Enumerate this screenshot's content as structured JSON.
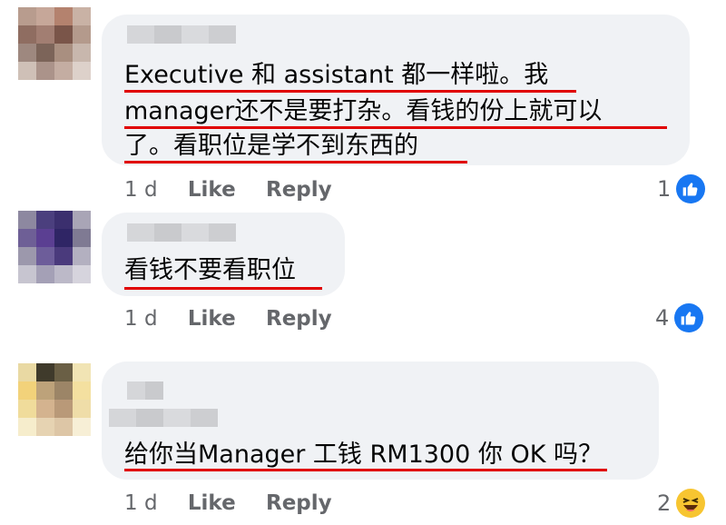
{
  "comments": [
    {
      "lines": [
        "Executive 和 assistant 都一样啦。我",
        "manager还不是要打杂。看钱的份上就可以",
        "了。看职位是学不到东西的"
      ],
      "time": "1 d",
      "like_label": "Like",
      "reply_label": "Reply",
      "reaction_count": "1",
      "reaction_icon": "like-icon"
    },
    {
      "lines": [
        "看钱不要看职位"
      ],
      "time": "1 d",
      "like_label": "Like",
      "reply_label": "Reply",
      "reaction_count": "4",
      "reaction_icon": "like-icon"
    },
    {
      "lines": [
        "给你当Manager 工钱 RM1300 你 OK 吗？"
      ],
      "time": "1 d",
      "like_label": "Like",
      "reply_label": "Reply",
      "reaction_count": "2",
      "reaction_icon": "haha-icon"
    }
  ],
  "colors": {
    "bubble": "#f0f2f5",
    "underline": "#e00000",
    "like_blue": "#1877f2",
    "haha_yellow": "#f7c531",
    "meta_gray": "#65676b"
  }
}
